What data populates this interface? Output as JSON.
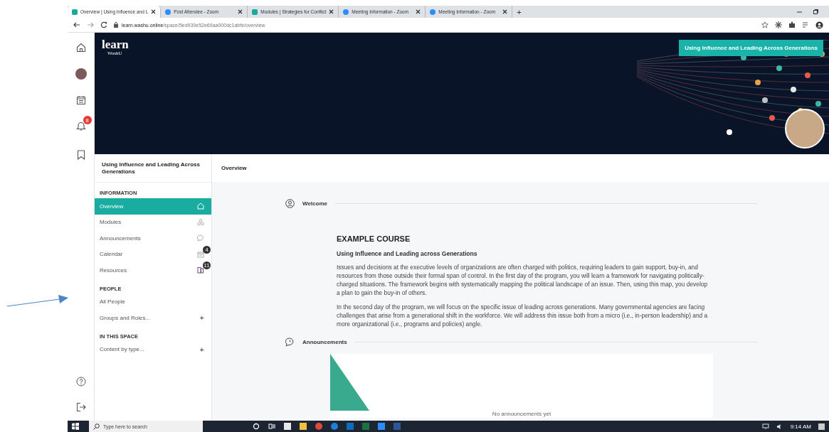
{
  "browser": {
    "tabs": [
      {
        "title": "Overview | Using Influence and L",
        "kind": "learn",
        "selected": true
      },
      {
        "title": "Post Attendee - Zoom",
        "kind": "zoom",
        "selected": false
      },
      {
        "title": "Modules | Strategies for Conflict",
        "kind": "learn",
        "selected": false
      },
      {
        "title": "Meeting Information - Zoom",
        "kind": "zoom",
        "selected": false
      },
      {
        "title": "Meeting Information - Zoom",
        "kind": "zoom",
        "selected": false
      }
    ],
    "new_tab": "+",
    "url": {
      "host": "learn.washu.online",
      "path": "/space/5ed930e52e69aa000dc1abfe/overview"
    }
  },
  "rail": {
    "notification_count": "8"
  },
  "banner": {
    "logo": "learn",
    "logo_sub": "WashU",
    "course_label": "Using Influence and Leading Across Generations"
  },
  "sidebar": {
    "title": "Using Influence and Leading Across Generations",
    "sections": [
      {
        "heading": "INFORMATION",
        "items": [
          {
            "label": "Overview",
            "kind": "home",
            "selected": true
          },
          {
            "label": "Modules",
            "kind": "modules",
            "selected": false
          },
          {
            "label": "Announcements",
            "kind": "announce",
            "selected": false
          },
          {
            "label": "Calendar",
            "kind": "calendar",
            "badge": "4",
            "selected": false
          },
          {
            "label": "Resources",
            "kind": "resources",
            "badge": "11",
            "selected": false
          }
        ]
      },
      {
        "heading": "PEOPLE",
        "items": [
          {
            "label": "All People",
            "selected": false
          },
          {
            "label": "Groups and Roles...",
            "action": "+",
            "selected": false
          }
        ]
      },
      {
        "heading": "IN THIS SPACE",
        "items": [
          {
            "label": "Content by type...",
            "action": "+",
            "selected": false
          }
        ]
      }
    ]
  },
  "breadcrumb": "Overview",
  "welcome": {
    "heading": "Welcome",
    "course_title": "EXAMPLE COURSE",
    "subtitle": "Using Influence and Leading across Generations",
    "paragraphs": [
      "Issues and decisions at the executive levels of organizations are often charged with politics, requiring leaders to gain support, buy-in, and resources from those outside their formal span of control. In the first day of the program, you will learn a framework for navigating politically-charged situations. The framework begins with systematically mapping the political landscape of an issue. Then, using this map, you develop a plan to gain the buy-in of others.",
      "In the second day of the program, we will focus on the specific issue of leading across generations. Many governmental agencies are facing challenges that arise from a generational shift in the workforce. We will address this issue both from a micro (i.e., in-person leadership) and a more organizational (i.e., programs and policies) angle."
    ]
  },
  "announcements": {
    "heading": "Announcements",
    "empty": "No announcements yet"
  },
  "taskbar": {
    "search_placeholder": "Type here to search",
    "time": "9:14 AM"
  }
}
